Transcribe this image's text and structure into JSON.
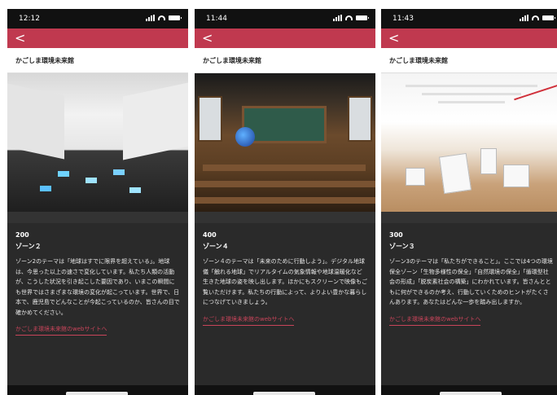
{
  "header_title": "かごしま環境未来館",
  "back_label": "<",
  "screens": [
    {
      "time": "12:12",
      "number": "200",
      "zone": "ゾーン２",
      "description": "ゾーン2のテーマは「地球はすでに限界を超えている」。地球は、今思った以上の速さで変化しています。私たち人類の活動が、こうした状況を引き起こした要因であり、いまこの瞬間にも世界ではさまざまな環境の変化が起こっています。世界で、日本で、鹿児島でどんなことが今起こっているのか、皆さんの目で確かめてください。",
      "link": "かごしま環境未来館のwebサイトへ",
      "photo_alt": "exhibition corridor with floor projections"
    },
    {
      "time": "11:44",
      "number": "400",
      "zone": "ゾーン４",
      "description": "ゾーン４のテーマは「未来のために行動しよう」。デジタル地球儀「触れる地球」でリアルタイムの気象情報や地球温暖化など生きた地球の姿を映し出します。ほかにもスクリーンで映像もご覧いただけます。私たちの行動によって、よりよい豊かな暮らしにつなげていきましょう。",
      "link": "かごしま環境未来館のwebサイトへ",
      "photo_alt": "classroom with digital globe"
    },
    {
      "time": "11:43",
      "number": "300",
      "zone": "ゾーン３",
      "description": "ゾーン3のテーマは「私たちができること」。ここでは4つの環境保全ゾーン「生物多様性の保全」「自然環境の保全」「循環型社会の形成」「脱炭素社会の構築」にわかれています。皆さんとともに何ができるのか考え、行動していくためのヒントがたくさんあります。あなたはどんな一歩を踏み出しますか。",
      "link": "かごしま環境未来館のwebサイトへ",
      "photo_alt": "bright hall with exhibition panels"
    }
  ],
  "colors": {
    "accent": "#c0394f",
    "link": "#c8445a",
    "content_bg": "#2a2a2a"
  },
  "icons": [
    "back-arrow-icon",
    "cellular-signal-icon",
    "wifi-icon",
    "battery-icon"
  ]
}
